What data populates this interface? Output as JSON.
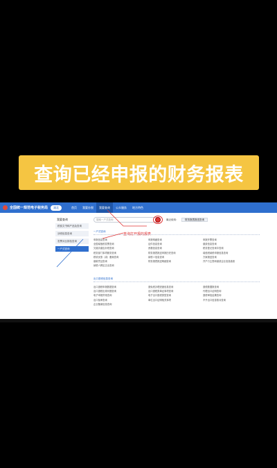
{
  "banner": {
    "title": "查询已经申报的财务报表"
  },
  "site": {
    "title": "全国统一规范电子税务局",
    "region": "湖北"
  },
  "nav": {
    "items": [
      "首页",
      "我要办税",
      "我要查询",
      "公众服务",
      "地方特色"
    ],
    "active_index": 2
  },
  "sidebar": {
    "title": "我要查询",
    "items": [
      {
        "label": "税费文书和产品及查询",
        "active": false
      },
      {
        "label": "涉税信息查询",
        "active": false
      },
      {
        "label": "发票对比核检查询",
        "active": false
      },
      {
        "label": "一户式查询",
        "active": true
      }
    ]
  },
  "search": {
    "placeholder": "搜索一户式查询",
    "recent_label": "最近使用：",
    "recent_chip": "财务报表报送查询"
  },
  "annotation": {
    "text": "查询打开报的报表"
  },
  "sections": [
    {
      "title": "一户式查询",
      "rows": [
        [
          "申报信息查询",
          "申报明细查询",
          "申报开票查询"
        ],
        [
          "全国增值税发票查询",
          "证件信息查询",
          "缴费信息查询"
        ],
        [
          "欠缴清缴应补税查询",
          "资格信息查询",
          "税务登记查询中查询"
        ],
        [
          "税务部门事项服务查询",
          "财务报表报送申报历史查询",
          "增值税纳税申报信息查询"
        ],
        [
          "税收优惠（减）备案查询",
          "纳税人信息查询",
          "方案报送查询"
        ],
        [
          "缴款凭证查询",
          "财务报表报送明细查询",
          "开户行主表和缴费企业信息缴费"
        ],
        [
          "纳税人跨区迁出查询",
          "",
          ""
        ]
      ]
    },
    {
      "title": "出口退税信息查询",
      "rows": [
        [
          "出口退税申报数据查询",
          "退免税办理进度信息查询",
          "退税数据报查询"
        ],
        [
          "出口退税出现问题查询",
          "出口退税类单证事项查询",
          "代理出口证明查询"
        ],
        [
          "电子申报异常查询",
          "电子出口退税类型查询",
          "退税审批结果查询"
        ],
        [
          "出口免审查询",
          "单位出口证明相关事项",
          "不予出口信息核对查询"
        ],
        [
          "企业备案信息查询",
          "",
          ""
        ]
      ]
    }
  ],
  "colors": {
    "banner": "#f5c542",
    "nav": "#2f6fce",
    "annotation": "#e03131"
  }
}
